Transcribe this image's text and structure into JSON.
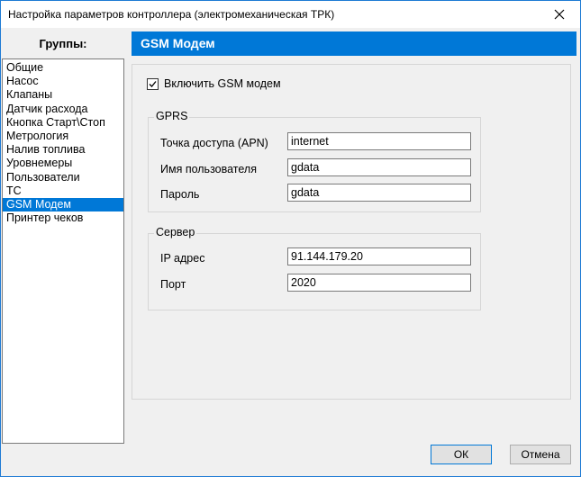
{
  "window": {
    "title": "Настройка параметров контроллера (электромеханическая ТРК)"
  },
  "groups": {
    "header": "Группы:",
    "items": [
      "Общие",
      "Насос",
      "Клапаны",
      "Датчик расхода",
      "Кнопка Старт\\Стоп",
      "Метрология",
      "Налив топлива",
      "Уровнемеры",
      "Пользователи",
      "ТС",
      "GSM Модем",
      "Принтер чеков"
    ],
    "selected_index": 10
  },
  "section": {
    "title": "GSM Модем"
  },
  "gsm": {
    "enable_label": "Включить GSM модем",
    "enabled": true
  },
  "gprs": {
    "title": "GPRS",
    "apn_label": "Точка доступа (APN)",
    "apn_value": "internet",
    "user_label": "Имя пользователя",
    "user_value": "gdata",
    "password_label": "Пароль",
    "password_value": "gdata"
  },
  "server": {
    "title": "Сервер",
    "ip_label": "IP адрес",
    "ip_value": "91.144.179.20",
    "port_label": "Порт",
    "port_value": "2020"
  },
  "buttons": {
    "ok": "ОК",
    "cancel": "Отмена"
  },
  "colors": {
    "accent": "#0078d7"
  }
}
